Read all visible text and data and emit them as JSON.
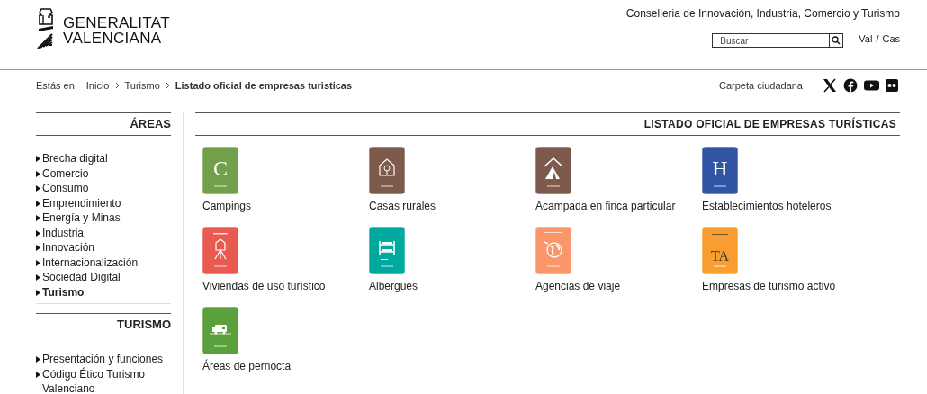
{
  "header": {
    "logo_text": [
      "GENERALITAT",
      "VALENCIANA"
    ],
    "department": "Conselleria de Innovación, Industria, Comercio y Turismo",
    "search": {
      "placeholder": "Buscar"
    },
    "languages": [
      {
        "label": "Val"
      },
      {
        "label": "Cas"
      }
    ],
    "language_separator": "/"
  },
  "breadcrumb": {
    "label": "Estás en",
    "items": [
      {
        "label": "Inicio",
        "current": false
      },
      {
        "label": "Turismo",
        "current": false
      },
      {
        "label": "Listado oficial de empresas turisticas",
        "current": true
      }
    ]
  },
  "citizen_link": "Carpeta ciudadana",
  "social": [
    {
      "kind": "x"
    },
    {
      "kind": "facebook"
    },
    {
      "kind": "youtube"
    },
    {
      "kind": "flickr"
    }
  ],
  "sidebar": [
    {
      "title": "ÁREAS",
      "items": [
        {
          "label": "Brecha digital",
          "selected": false
        },
        {
          "label": "Comercio",
          "selected": false
        },
        {
          "label": "Consumo",
          "selected": false
        },
        {
          "label": "Emprendimiento",
          "selected": false
        },
        {
          "label": "Energía y Minas",
          "selected": false
        },
        {
          "label": "Industria",
          "selected": false
        },
        {
          "label": "Innovación",
          "selected": false
        },
        {
          "label": "Internacionalización",
          "selected": false
        },
        {
          "label": "Sociedad Digital",
          "selected": false
        },
        {
          "label": "Turismo",
          "selected": true
        }
      ]
    },
    {
      "title": "TURISMO",
      "items": [
        {
          "label": "Presentación y funciones",
          "selected": false
        },
        {
          "label": "Código Ético Turismo Valenciano",
          "selected": false
        }
      ]
    }
  ],
  "main": {
    "title": "LISTADO OFICIAL DE EMPRESAS TURÍSTICAS",
    "categories": [
      {
        "label": "Campings",
        "kind": "letter",
        "color": "#72a04a",
        "plaque_text": "C"
      },
      {
        "label": "Casas rurales",
        "kind": "house",
        "color": "#7d5a4c"
      },
      {
        "label": "Acampada en finca particular",
        "kind": "tent",
        "color": "#7d5a4c"
      },
      {
        "label": "Establecimientos hoteleros",
        "kind": "letter",
        "color": "#2f55a4",
        "plaque_text": "H"
      },
      {
        "label": "Viviendas de uso turístico",
        "kind": "keys",
        "color": "#e95a50"
      },
      {
        "label": "Albergues",
        "kind": "bunk",
        "color": "#00a99d"
      },
      {
        "label": "Agencias de viaje",
        "kind": "globe",
        "color": "#f9966a"
      },
      {
        "label": "Empresas de turismo activo",
        "kind": "active",
        "color": "#f99d31",
        "plaque_text": "TA"
      },
      {
        "label": "Áreas de pernocta",
        "kind": "camper",
        "color": "#5aa03c"
      }
    ]
  }
}
